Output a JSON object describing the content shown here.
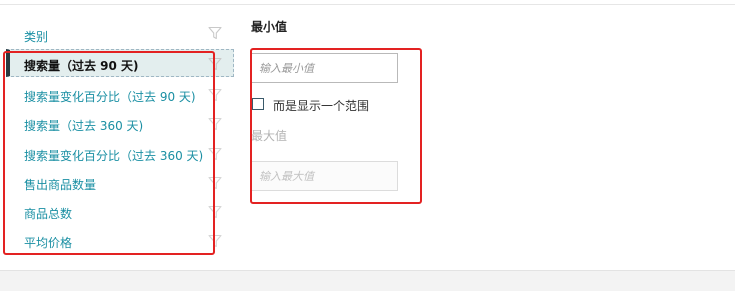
{
  "filter": {
    "category_header": "类别",
    "items": [
      {
        "label": "搜索量（过去 90 天)",
        "selected": true
      },
      {
        "label": "搜索量变化百分比（过去 90 天)",
        "selected": false
      },
      {
        "label": "搜索量（过去 360 天)",
        "selected": false
      },
      {
        "label": "搜索量变化百分比（过去 360 天)",
        "selected": false
      },
      {
        "label": "售出商品数量",
        "selected": false
      },
      {
        "label": "商品总数",
        "selected": false
      },
      {
        "label": "平均价格",
        "selected": false
      }
    ]
  },
  "range_panel": {
    "min_title": "最小值",
    "min_placeholder": "输入最小值",
    "range_checkbox_label": "而是显示一个范围",
    "range_checked": false,
    "max_title": "最大值",
    "max_placeholder": "输入最大值"
  },
  "colors": {
    "link_teal": "#1a8fa3",
    "selected_bg": "#e3eeee",
    "annotation_red": "#e32222"
  },
  "icons": {
    "filter": "funnel-icon"
  }
}
